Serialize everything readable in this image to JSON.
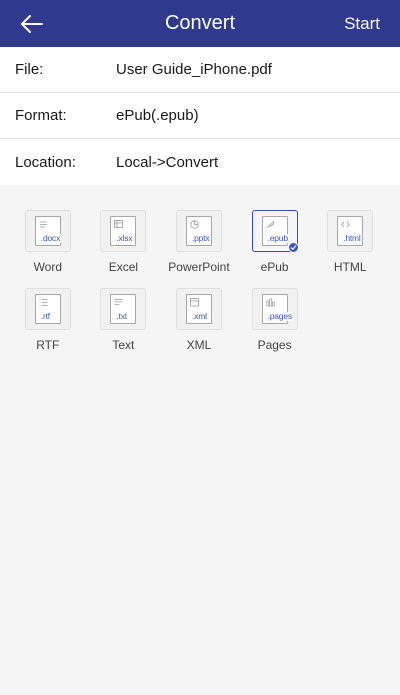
{
  "header": {
    "title": "Convert",
    "start_label": "Start"
  },
  "info": [
    {
      "label": "File:",
      "value": "User Guide_iPhone.pdf"
    },
    {
      "label": "Format:",
      "value": "ePub(.epub)"
    },
    {
      "label": "Location:",
      "value": "Local->Convert"
    }
  ],
  "formats": [
    {
      "label": "Word",
      "ext": ".docx",
      "icon": "text-lines-icon",
      "selected": false
    },
    {
      "label": "Excel",
      "ext": ".xlsx",
      "icon": "table-icon",
      "selected": false
    },
    {
      "label": "PowerPoint",
      "ext": ".pptx",
      "icon": "pie-icon",
      "selected": false
    },
    {
      "label": "ePub",
      "ext": ".epub",
      "icon": "feather-icon",
      "selected": true
    },
    {
      "label": "HTML",
      "ext": ".html",
      "icon": "code-icon",
      "selected": false
    },
    {
      "label": "RTF",
      "ext": ".rtf",
      "icon": "list-icon",
      "selected": false
    },
    {
      "label": "Text",
      "ext": ".txt",
      "icon": "text-block-icon",
      "selected": false
    },
    {
      "label": "XML",
      "ext": ".xml",
      "icon": "frame-icon",
      "selected": false
    },
    {
      "label": "Pages",
      "ext": ".pages",
      "icon": "chart-icon",
      "selected": false
    }
  ],
  "colors": {
    "header_bg": "#2f3a8f",
    "accent": "#3a55c6"
  }
}
